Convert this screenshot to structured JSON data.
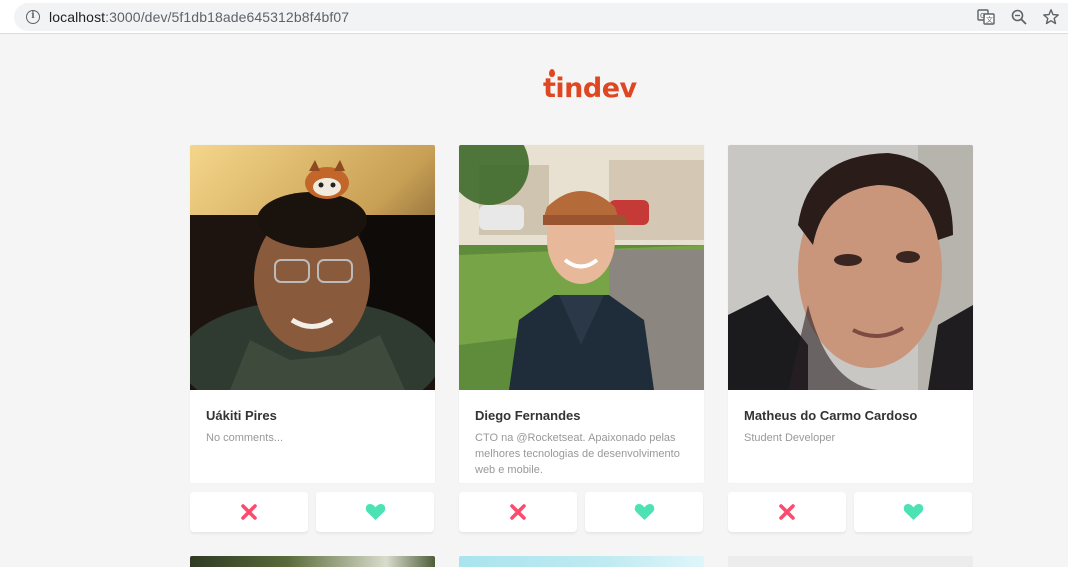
{
  "browser": {
    "url_host": "localhost",
    "url_path": ":3000/dev/5f1db18ade645312b8f4bf07",
    "icons": [
      "info-icon",
      "translate-icon",
      "zoom-icon",
      "star-icon"
    ]
  },
  "app": {
    "logo_text": "tindev",
    "colors": {
      "brand": "#df4723",
      "dislike": "#fc4b6c",
      "like": "#4de2b3",
      "background": "#f5f5f5"
    }
  },
  "devs": [
    {
      "name": "Uákiti Pires",
      "bio": "No comments..."
    },
    {
      "name": "Diego Fernandes",
      "bio": "CTO na @Rocketseat. Apaixonado pelas melhores tecnologias de desenvolvimento web e mobile."
    },
    {
      "name": "Matheus do Carmo Cardoso",
      "bio": "Student Developer"
    }
  ],
  "actions": {
    "dislike_icon": "x-icon",
    "like_icon": "heart-icon"
  }
}
